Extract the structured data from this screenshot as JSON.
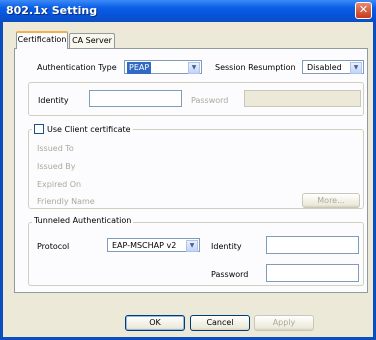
{
  "window": {
    "title": "802.1x Setting",
    "close_symbol": "✕"
  },
  "tabs": [
    {
      "label": "Certification",
      "active": true
    },
    {
      "label": "CA Server",
      "active": false
    }
  ],
  "certification": {
    "auth_type_label": "Authentication Type",
    "auth_type_value": "PEAP",
    "session_resumption_label": "Session Resumption",
    "session_resumption_value": "Disabled",
    "identity_label": "Identity",
    "identity_value": "",
    "password_label": "Password",
    "password_value": ""
  },
  "client_cert": {
    "checkbox_label": "Use Client certificate",
    "checked": false,
    "fields": [
      "Issued To",
      "Issued By",
      "Expired On",
      "Friendly Name"
    ],
    "more_button": "More..."
  },
  "tunneled": {
    "legend": "Tunneled Authentication",
    "protocol_label": "Protocol",
    "protocol_value": "EAP-MSCHAP v2",
    "identity_label": "Identity",
    "identity_value": "",
    "password_label": "Password",
    "password_value": ""
  },
  "buttons": {
    "ok": "OK",
    "cancel": "Cancel",
    "apply": "Apply"
  },
  "icons": {
    "dropdown": "▼"
  }
}
